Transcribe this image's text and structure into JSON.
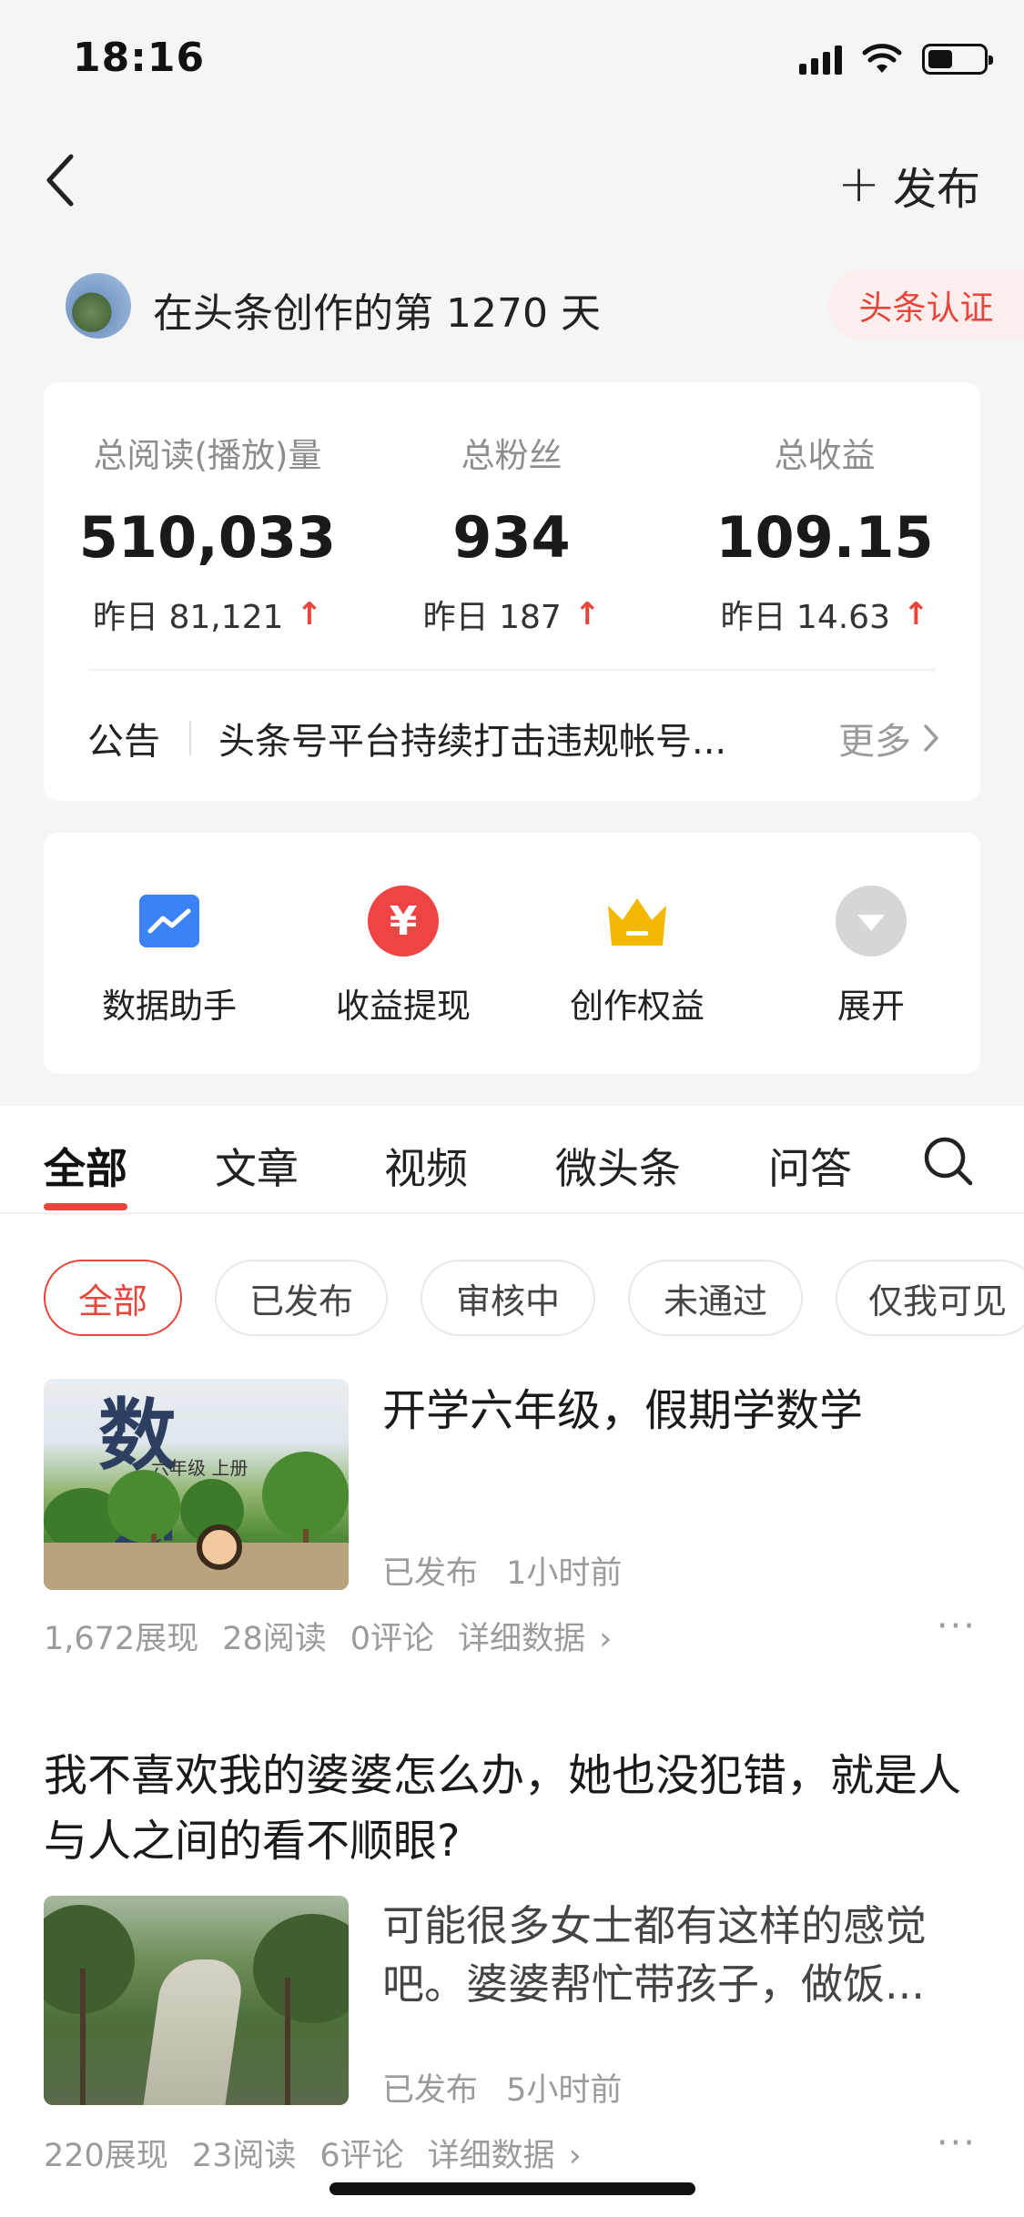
{
  "status_bar": {
    "time": "18:16"
  },
  "nav": {
    "publish_label": "发布"
  },
  "creator": {
    "days_text": "在头条创作的第 1270 天",
    "verify_label": "头条认证"
  },
  "stats": [
    {
      "label": "总阅读(播放)量",
      "value": "510,033",
      "delta": "昨日 81,121"
    },
    {
      "label": "总粉丝",
      "value": "934",
      "delta": "昨日 187"
    },
    {
      "label": "总收益",
      "value": "109.15",
      "delta": "昨日 14.63"
    }
  ],
  "notice": {
    "label": "公告",
    "text": "头条号平台持续打击违规帐号...",
    "more": "更多"
  },
  "tools": [
    {
      "label": "数据助手",
      "icon": "chart-icon",
      "color": "#3b82f6"
    },
    {
      "label": "收益提现",
      "icon": "yuan-icon",
      "color": "#ef4444"
    },
    {
      "label": "创作权益",
      "icon": "crown-icon",
      "color": "#f5b700"
    },
    {
      "label": "展开",
      "icon": "expand-icon",
      "color": "#cfcfcf"
    }
  ],
  "tabs": [
    "全部",
    "文章",
    "视频",
    "微头条",
    "问答"
  ],
  "filters": [
    "全部",
    "已发布",
    "审核中",
    "未通过",
    "仅我可见"
  ],
  "articles": [
    {
      "title": "开学六年级，假期学数学",
      "status": "已发布",
      "time": "1小时前",
      "impressions": "1,672展现",
      "reads": "28阅读",
      "comments": "0评论",
      "detail": "详细数据",
      "thumb_text": "数 学",
      "thumb_grade": "六年级 上册"
    },
    {
      "title": "我不喜欢我的婆婆怎么办，她也没犯错，就是人与人之间的看不顺眼?",
      "summary": "可能很多女士都有这样的感觉吧。婆婆帮忙带孩子，做饭...",
      "status": "已发布",
      "time": "5小时前",
      "impressions": "220展现",
      "reads": "23阅读",
      "comments": "6评论",
      "detail": "详细数据"
    }
  ],
  "colors": {
    "accent": "#e8453c",
    "muted": "#9b9b9b"
  }
}
